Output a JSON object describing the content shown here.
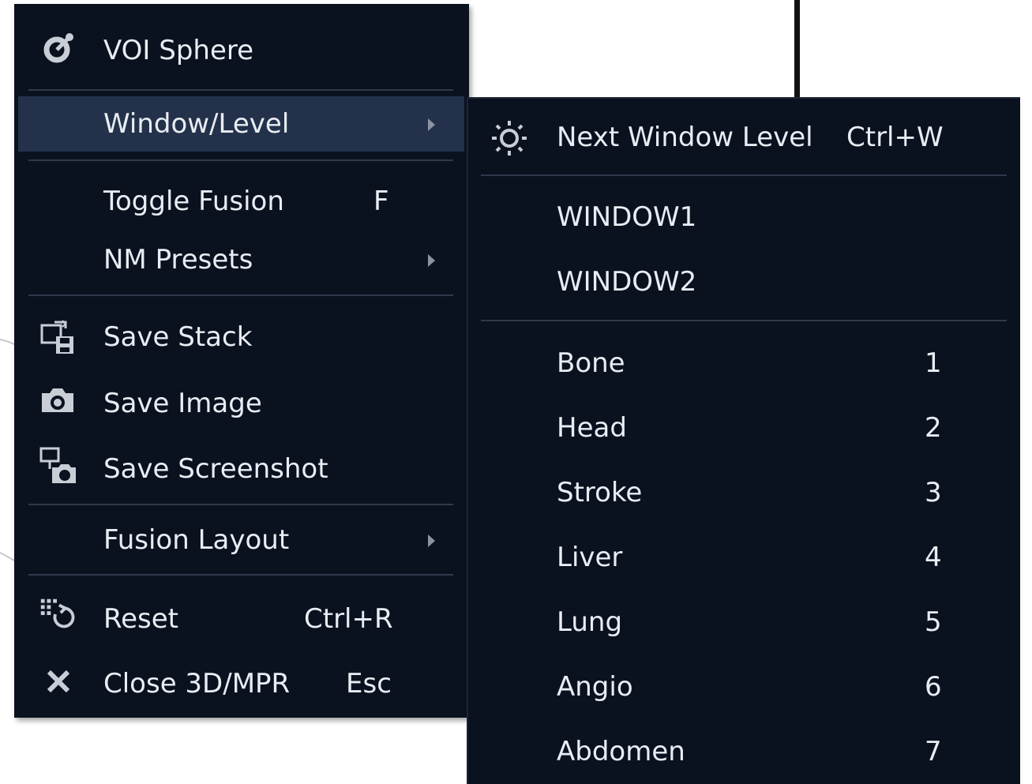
{
  "main_menu": {
    "items": [
      {
        "label": "VOI Sphere",
        "icon": "voi-sphere-icon"
      },
      {
        "label": "Window/Level",
        "has_submenu": true,
        "highlighted": true
      },
      {
        "label": "Toggle Fusion",
        "shortcut": "F"
      },
      {
        "label": "NM Presets",
        "has_submenu": true
      },
      {
        "label": "Save Stack",
        "icon": "save-stack-icon"
      },
      {
        "label": "Save Image",
        "icon": "camera-icon"
      },
      {
        "label": "Save Screenshot",
        "icon": "screenshot-icon"
      },
      {
        "label": "Fusion Layout",
        "has_submenu": true
      },
      {
        "label": "Reset",
        "shortcut": "Ctrl+R",
        "icon": "reset-icon"
      },
      {
        "label": "Close 3D/MPR",
        "shortcut": "Esc",
        "icon": "close-icon"
      }
    ]
  },
  "window_level_submenu": {
    "items": [
      {
        "label": "Next Window Level",
        "shortcut": "Ctrl+W",
        "icon": "brightness-icon"
      },
      {
        "label": "WINDOW1"
      },
      {
        "label": "WINDOW2"
      },
      {
        "label": "Bone",
        "shortcut": "1"
      },
      {
        "label": "Head",
        "shortcut": "2"
      },
      {
        "label": "Stroke",
        "shortcut": "3"
      },
      {
        "label": "Liver",
        "shortcut": "4"
      },
      {
        "label": "Lung",
        "shortcut": "5"
      },
      {
        "label": "Angio",
        "shortcut": "6"
      },
      {
        "label": "Abdomen",
        "shortcut": "7"
      }
    ]
  },
  "colors": {
    "menu_background": "#0a1220",
    "highlight": "#23324a",
    "text": "#e9edf3",
    "separator": "#2e3a4c"
  }
}
